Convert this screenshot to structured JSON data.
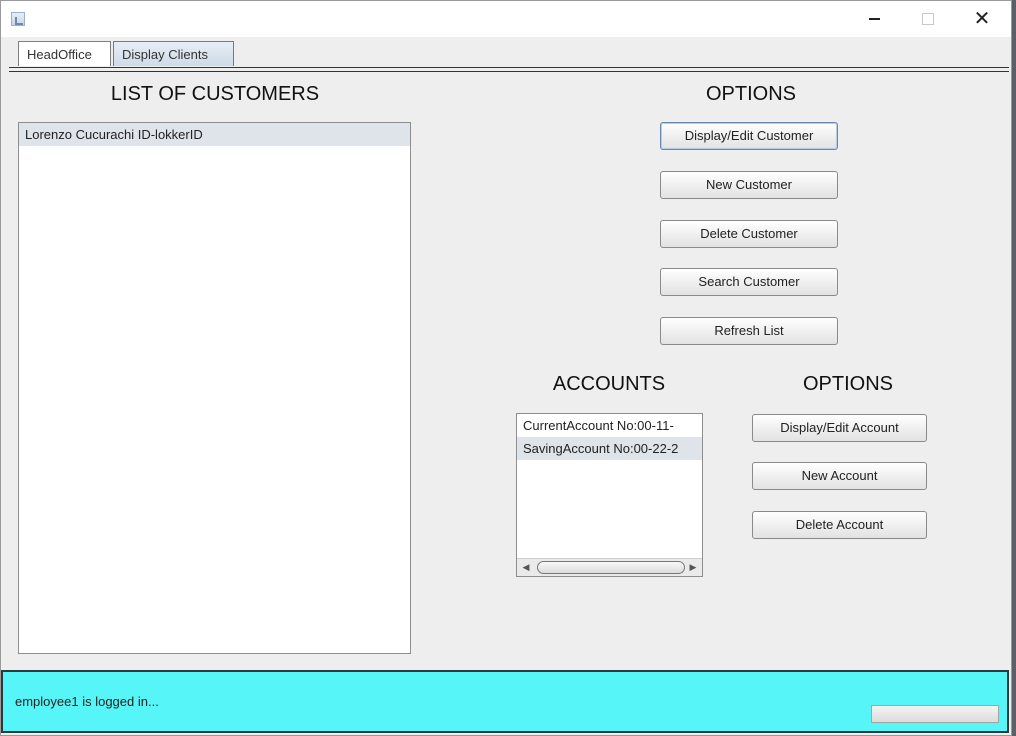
{
  "window": {
    "title": "",
    "controls": {
      "minimize": "minimize-icon",
      "maximize": "maximize-icon",
      "close": "✕"
    }
  },
  "tabs": [
    {
      "label": "HeadOffice"
    },
    {
      "label": "Display Clients",
      "selected": true
    }
  ],
  "customers": {
    "heading": "LIST OF CUSTOMERS",
    "items": [
      {
        "label": "Lorenzo Cucurachi   ID-lokkerID",
        "selected": true
      }
    ]
  },
  "customer_options": {
    "heading": "OPTIONS",
    "buttons": [
      {
        "label": "Display/Edit Customer"
      },
      {
        "label": "New Customer"
      },
      {
        "label": "Delete Customer"
      },
      {
        "label": "Search Customer"
      },
      {
        "label": "Refresh List"
      }
    ]
  },
  "accounts": {
    "heading": "ACCOUNTS",
    "items": [
      {
        "label": "CurrentAccount  No:00-11-"
      },
      {
        "label": "SavingAccount  No:00-22-2",
        "selected": true
      }
    ]
  },
  "account_options": {
    "heading": "OPTIONS",
    "buttons": [
      {
        "label": "Display/Edit Account"
      },
      {
        "label": "New Account"
      },
      {
        "label": "Delete Account"
      }
    ]
  },
  "status": {
    "message": "employee1 is logged in...",
    "background": "#56f6f8"
  }
}
